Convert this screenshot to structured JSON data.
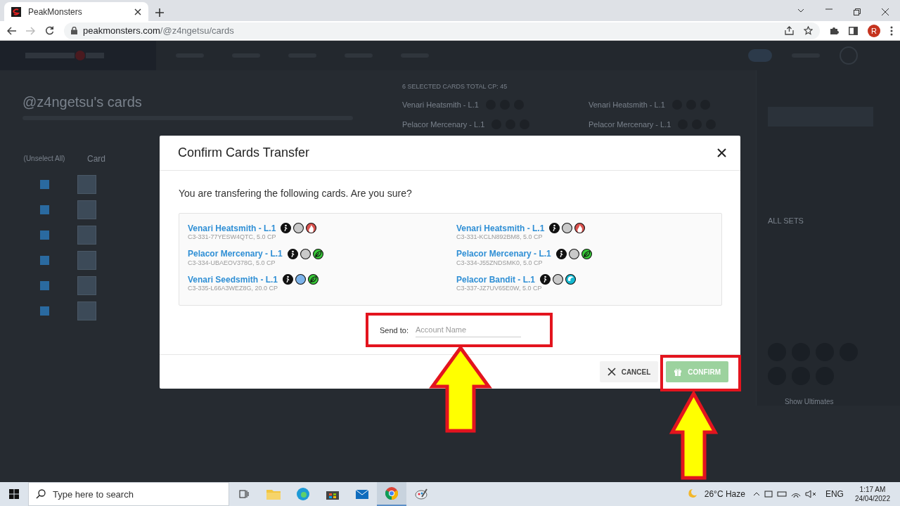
{
  "browser": {
    "tab_title": "PeakMonsters",
    "url_domain": "peakmonsters.com",
    "url_path": "/@z4ngetsu/cards",
    "avatar_letter": "R"
  },
  "page": {
    "toggle": {
      "on": false
    },
    "heading": "@z4ngetsu's cards",
    "select_all": "(Unselect All)",
    "card_column": "Card",
    "rows": [
      {
        "checked": true
      },
      {
        "checked": true
      },
      {
        "checked": true
      },
      {
        "checked": true
      },
      {
        "checked": true
      },
      {
        "checked": true
      }
    ],
    "selected_title": "6 SELECTED CARDS TOTAL CP: 45",
    "selected_cards": [
      "Venari Heatsmith - L.1",
      "Venari Heatsmith - L.1",
      "Pelacor Mercenary - L.1",
      "Pelacor Mercenary - L.1"
    ],
    "set_filter": "ALL SETS",
    "show_ultimates": "Show Ultimates"
  },
  "dialog": {
    "title": "Confirm Cards Transfer",
    "message": "You are transfering the following cards. Are you sure?",
    "cards": [
      {
        "name": "Venari Heatsmith - L.1",
        "detail": "C3-331-77YESW4QTC, 5.0 CP",
        "icons": [
          {
            "kind": "runner"
          },
          {
            "kind": "disc",
            "color": "#c9c9c9"
          },
          {
            "kind": "flame",
            "color": "#d9534f"
          }
        ]
      },
      {
        "name": "Venari Heatsmith - L.1",
        "detail": "C3-331-KCLN892BM8, 5.0 CP",
        "icons": [
          {
            "kind": "runner"
          },
          {
            "kind": "disc",
            "color": "#c9c9c9"
          },
          {
            "kind": "flame",
            "color": "#d9534f"
          }
        ]
      },
      {
        "name": "Pelacor Mercenary - L.1",
        "detail": "C3-334-UBAEOV378G, 5.0 CP",
        "icons": [
          {
            "kind": "runner"
          },
          {
            "kind": "disc",
            "color": "#c9c9c9"
          },
          {
            "kind": "leaf",
            "color": "#37c837"
          }
        ]
      },
      {
        "name": "Pelacor Mercenary - L.1",
        "detail": "C3-334-J55ZNDSMK0, 5.0 CP",
        "icons": [
          {
            "kind": "runner"
          },
          {
            "kind": "disc",
            "color": "#c9c9c9"
          },
          {
            "kind": "leaf",
            "color": "#37c837"
          }
        ]
      },
      {
        "name": "Venari Seedsmith - L.1",
        "detail": "C3-335-L66A3WEZ8G, 20.0 CP",
        "icons": [
          {
            "kind": "runner"
          },
          {
            "kind": "disc",
            "color": "#7cb3ea"
          },
          {
            "kind": "leaf",
            "color": "#37c837"
          }
        ]
      },
      {
        "name": "Pelacor Bandit - L.1",
        "detail": "C3-337-JZ7UV65E0W, 5.0 CP",
        "icons": [
          {
            "kind": "runner"
          },
          {
            "kind": "disc",
            "color": "#c9c9c9"
          },
          {
            "kind": "wave",
            "color": "#14b8d0"
          }
        ]
      }
    ],
    "send_to": {
      "label": "Send to:",
      "placeholder": "Account Name"
    },
    "buttons": [
      {
        "label": "CANCEL",
        "kind": "cancel",
        "disabled": false
      },
      {
        "label": "CONFIRM",
        "kind": "confirm",
        "disabled": true
      }
    ]
  },
  "taskbar": {
    "search_placeholder": "Type here to search",
    "weather": "26°C Haze",
    "language": "ENG",
    "time": "1:17 AM",
    "date": "24/04/2022"
  }
}
